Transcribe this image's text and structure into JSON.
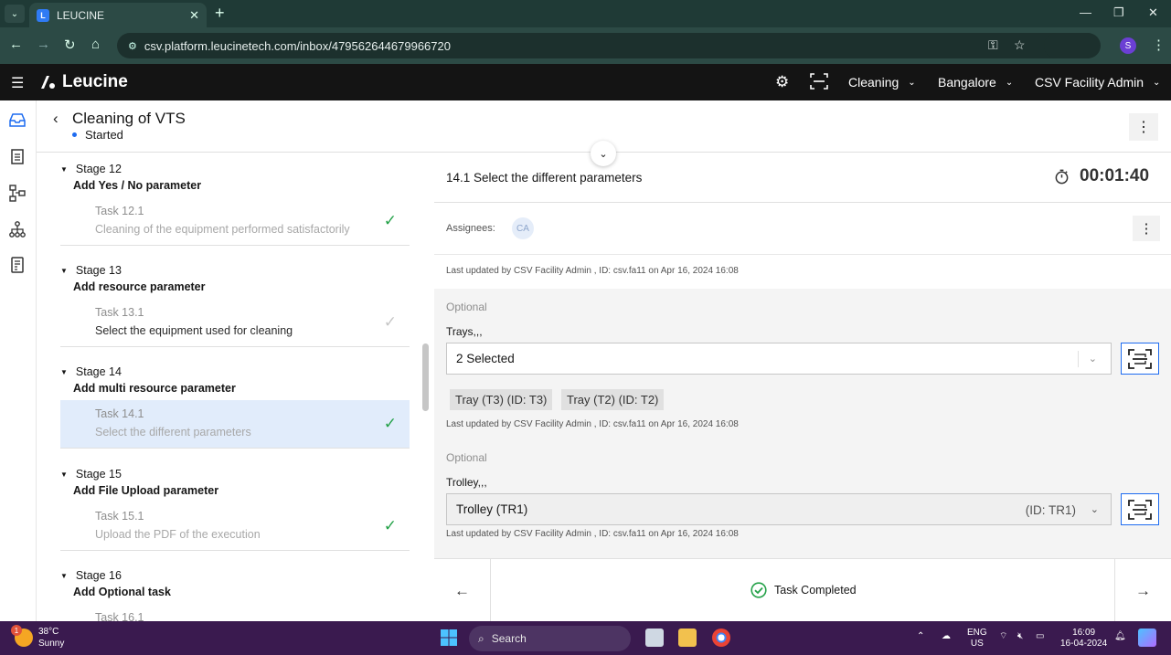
{
  "browser": {
    "tab_title": "LEUCINE",
    "url": "csv.platform.leucinetech.com/inbox/479562644679966720"
  },
  "appbar": {
    "brand": "Leucine",
    "use_case": "Cleaning",
    "facility": "Bangalore",
    "user": "CSV Facility Admin"
  },
  "job": {
    "title": "Cleaning of VTS",
    "state": "Started"
  },
  "stages": [
    {
      "label": "Stage 12",
      "name": "Add Yes / No parameter",
      "task": {
        "num": "Task 12.1",
        "name": "Cleaning of the equipment performed satisfactorily"
      }
    },
    {
      "label": "Stage 13",
      "name": "Add resource parameter",
      "task": {
        "num": "Task 13.1",
        "name": "Select the equipment used for cleaning"
      }
    },
    {
      "label": "Stage 14",
      "name": "Add multi resource parameter",
      "task": {
        "num": "Task 14.1",
        "name": "Select the different parameters"
      }
    },
    {
      "label": "Stage 15",
      "name": "Add File Upload parameter",
      "task": {
        "num": "Task 15.1",
        "name": "Upload the PDF of the execution"
      }
    },
    {
      "label": "Stage 16",
      "name": "Add Optional task",
      "task": {
        "num": "Task 16.1",
        "name": ""
      }
    }
  ],
  "task_view": {
    "title": "14.1 Select the different parameters",
    "timer": "00:01:40",
    "assignees_label": "Assignees:",
    "assignee_initials": "CA",
    "last_updated_task": "Last updated by CSV Facility Admin , ID: csv.fa11 on Apr 16, 2024 16:08",
    "param1": {
      "optional": "Optional",
      "label": "Trays,,,",
      "value": "2 Selected",
      "chips": [
        "Tray (T3) (ID: T3)",
        "Tray (T2) (ID: T2)"
      ],
      "last_updated": "Last updated by CSV Facility Admin , ID: csv.fa11 on Apr 16, 2024 16:08"
    },
    "param2": {
      "optional": "Optional",
      "label": "Trolley,,,",
      "value": "Trolley (TR1)",
      "value_id": "(ID: TR1)",
      "last_updated": "Last updated by CSV Facility Admin , ID: csv.fa11 on Apr 16, 2024 16:08"
    },
    "footer_status": "Task Completed"
  },
  "taskbar": {
    "temp": "38°C",
    "condition": "Sunny",
    "weather_badge": "1",
    "search_placeholder": "Search",
    "lang_top": "ENG",
    "lang_bottom": "US",
    "time": "16:09",
    "date": "16-04-2024"
  },
  "colors": {
    "accent": "#1d6bf0",
    "success": "#24a148",
    "appbar": "#141414",
    "taskbar": "#3a1a4f"
  }
}
